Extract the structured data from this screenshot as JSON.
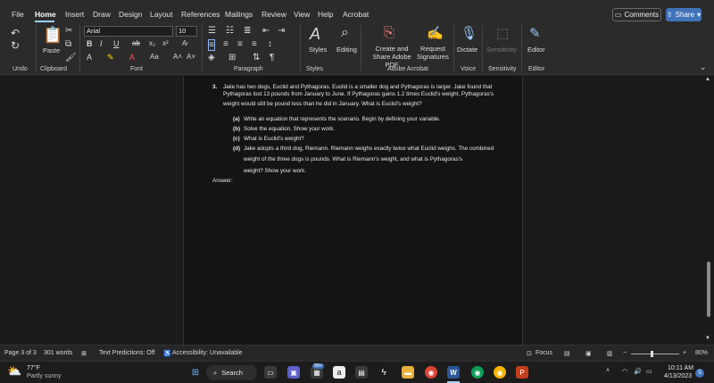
{
  "menubar": {
    "items": [
      "File",
      "Home",
      "Insert",
      "Draw",
      "Design",
      "Layout",
      "References",
      "Mailings",
      "Review",
      "View",
      "Help",
      "Acrobat"
    ],
    "comments_label": "Comments",
    "share_label": "Share"
  },
  "ribbon": {
    "font_name": "Arial",
    "font_size": "10",
    "paste_label": "Paste",
    "styles_label": "Styles",
    "editing_label": "Editing",
    "create_share_label": "Create and Share Adobe PDF",
    "request_sig_label": "Request Signatures",
    "dictate_label": "Dictate",
    "sensitivity_label": "Sensitivity",
    "editor_label": "Editor",
    "groups": {
      "undo": "Undo",
      "clipboard": "Clipboard",
      "font": "Font",
      "paragraph": "Paragraph",
      "styles": "Styles",
      "adobe": "Adobe Acrobat",
      "voice": "Voice",
      "sensitivity": "Sensitivity",
      "editor": "Editor"
    }
  },
  "document": {
    "problem_number": "3.",
    "problem_lines": [
      "Jake has two dogs, Euclid and Pythagoras. Euclid is a smaller dog and Pythagoras is larger. Jake found that",
      "Pythagoras lost 13 pounds from January to June. If Pythagoras gains 1.2 times Euclid's weight, Pythagoras's",
      "weight would still be          pound less than he did in January. What is Euclid's weight?"
    ],
    "parts": [
      {
        "label": "(a)",
        "text": "Write an equation that represents the scenario. Begin by defining your variable."
      },
      {
        "label": "(b)",
        "text": "Solve the equation. Show your work."
      },
      {
        "label": "(c)",
        "text": "What is Euclid's weight?"
      },
      {
        "label": "(d)",
        "text": "Jake adopts a third dog, Riemann. Riemann weighs exactly twice what Euclid weighs. The combined"
      }
    ],
    "part_d_line2": "weight of the three dogs is          pounds. What is Riemann's weight, and what is Pythagoras's",
    "part_d_line3": "weight? Show your work.",
    "answer_label": "Answer:"
  },
  "statusbar": {
    "page": "Page 3 of 3",
    "words": "301 words",
    "text_predictions": "Text Predictions: Off",
    "accessibility": "Accessibility: Unavailable",
    "focus": "Focus",
    "zoom": "80%"
  },
  "taskbar": {
    "weather_temp": "77°F",
    "weather_desc": "Partly sunny",
    "search_label": "Search",
    "badge": "99+",
    "time": "10:11 AM",
    "date": "4/13/2023",
    "notif_count": "5"
  }
}
